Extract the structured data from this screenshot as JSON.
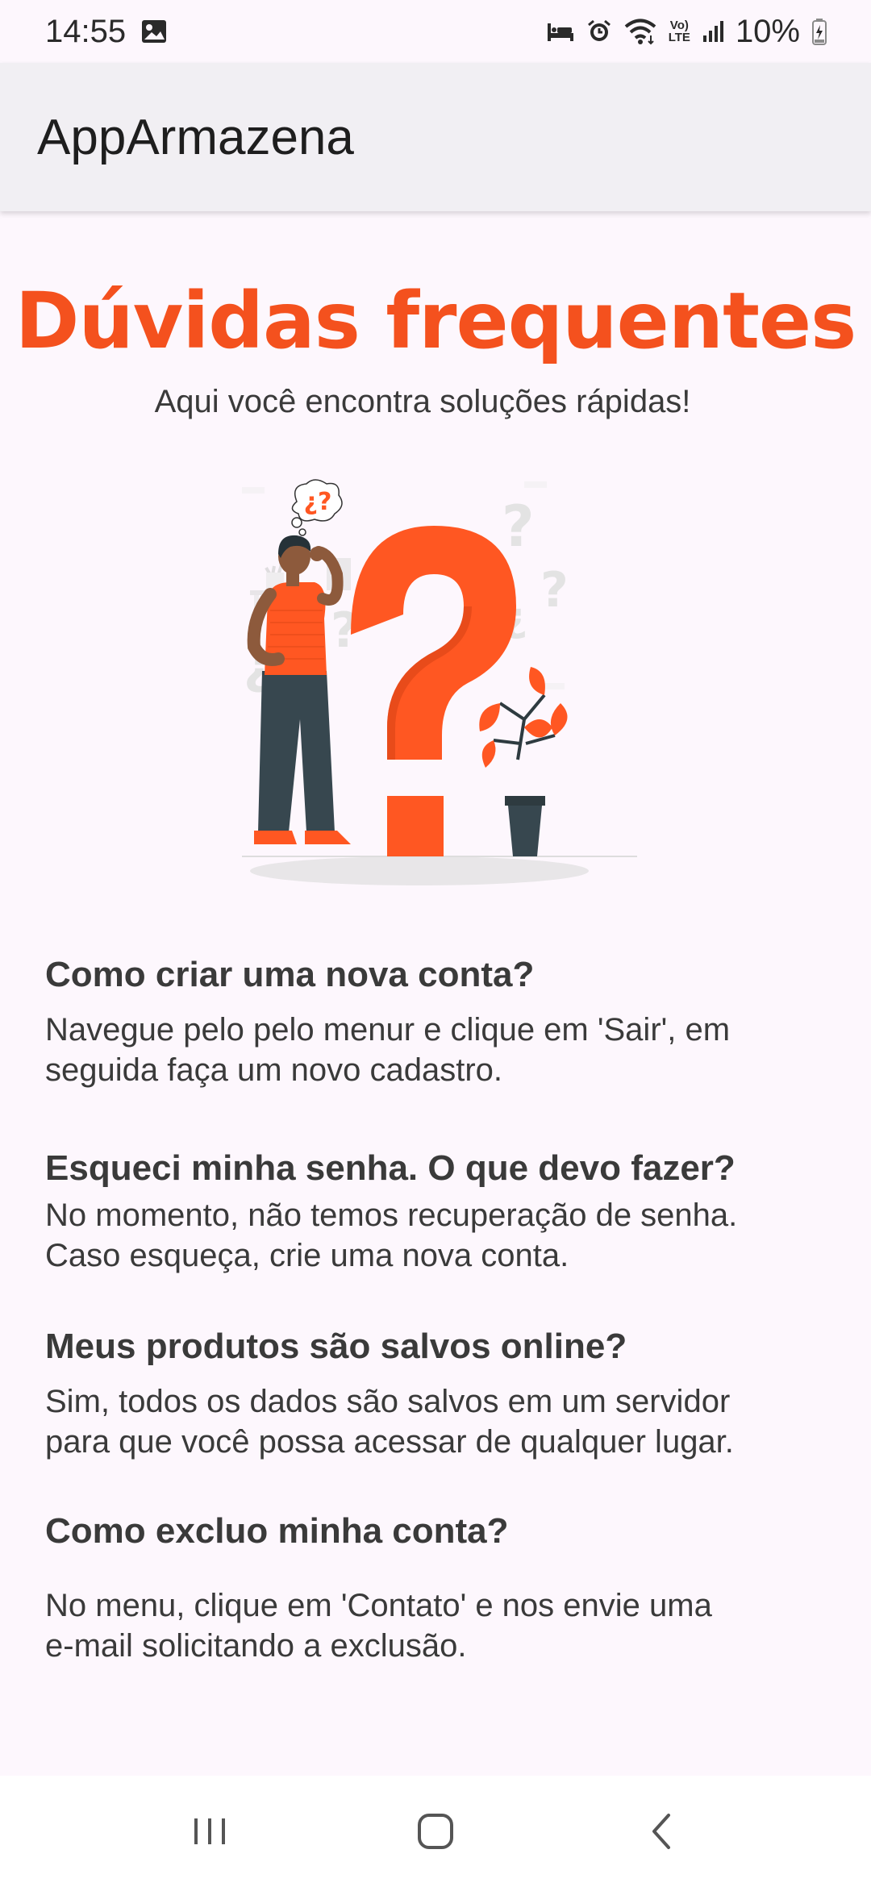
{
  "status_bar": {
    "time": "14:55",
    "battery": "10%",
    "icons": [
      "image-icon",
      "bed-icon",
      "alarm-icon",
      "wifi-icon",
      "volte-icon",
      "signal-icon",
      "battery-icon"
    ],
    "volte_top": "Vo)",
    "volte_bottom": "LTE"
  },
  "app_bar": {
    "title": "AppArmazena"
  },
  "page": {
    "title": "Dúvidas frequentes",
    "subtitle": "Aqui você encontra soluções rápidas!"
  },
  "illustration": {
    "thought_bubble": "¿?"
  },
  "faq": [
    {
      "question": "Como criar uma nova conta?",
      "answer_lines": [
        "Navegue pelo pelo menur e clique em 'Sair', em",
        "seguida faça um novo cadastro."
      ]
    },
    {
      "question": "Esqueci minha senha. O que devo fazer?",
      "answer_lines": [
        "No momento, não temos recuperação de senha.",
        "Caso esqueça, crie uma nova conta."
      ]
    },
    {
      "question": "Meus produtos são salvos online?",
      "answer_lines": [
        "Sim, todos os dados são salvos em um servidor",
        "para que você possa acessar de qualquer lugar."
      ]
    },
    {
      "question": "Como excluo minha conta?",
      "answer_lines": [
        "No menu, clique em 'Contato' e nos envie uma",
        "e-mail solicitando a exclusão."
      ]
    }
  ],
  "nav_bar": {
    "icons": [
      "recent-apps-icon",
      "home-icon",
      "back-icon"
    ]
  },
  "colors": {
    "accent": "#f4511e",
    "background": "#fdf7fd",
    "app_bar": "#f1eff3",
    "pants": "#37474f"
  }
}
